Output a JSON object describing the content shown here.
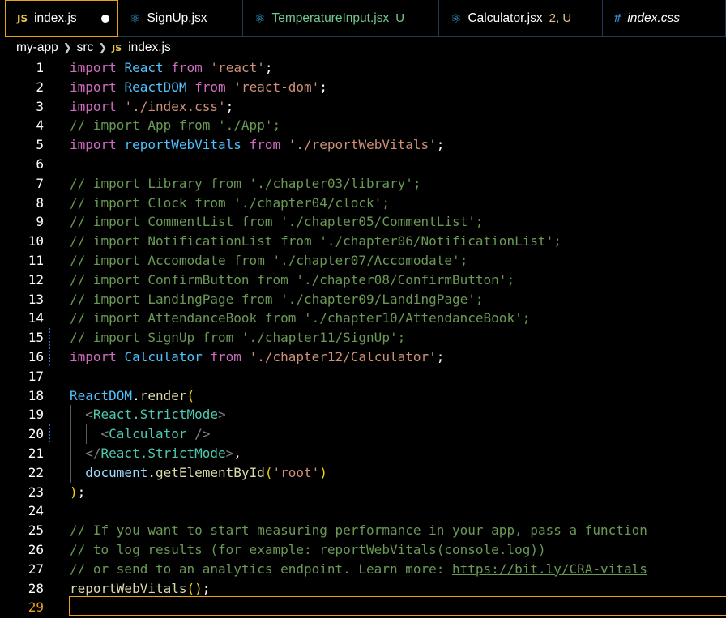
{
  "tabs": [
    {
      "label": "index.js",
      "icon": "js-icon",
      "icon_text": "JS",
      "status": "",
      "active": true,
      "dirty": true
    },
    {
      "label": "SignUp.jsx",
      "icon": "react-icon",
      "icon_text": "⚛",
      "status": "",
      "active": false
    },
    {
      "label": "TemperatureInput.jsx",
      "icon": "react-icon",
      "icon_text": "⚛",
      "status": "U",
      "active": false
    },
    {
      "label": "Calculator.jsx",
      "icon": "react-icon",
      "icon_text": "⚛",
      "status": "2, U",
      "active": false
    },
    {
      "label": "index.css",
      "icon": "css-icon",
      "icon_text": "#",
      "status": "",
      "active": false
    }
  ],
  "breadcrumb": {
    "root": "my-app",
    "folder": "src",
    "file": "index.js",
    "file_icon": "JS"
  },
  "lines": [
    [
      [
        "kw",
        "import"
      ],
      [
        "punc",
        " "
      ],
      [
        "id",
        "React"
      ],
      [
        "punc",
        " "
      ],
      [
        "kw",
        "from"
      ],
      [
        "punc",
        " "
      ],
      [
        "str",
        "'react'"
      ],
      [
        "punc",
        ";"
      ]
    ],
    [
      [
        "kw",
        "import"
      ],
      [
        "punc",
        " "
      ],
      [
        "id",
        "ReactDOM"
      ],
      [
        "punc",
        " "
      ],
      [
        "kw",
        "from"
      ],
      [
        "punc",
        " "
      ],
      [
        "str",
        "'react-dom'"
      ],
      [
        "punc",
        ";"
      ]
    ],
    [
      [
        "kw",
        "import"
      ],
      [
        "punc",
        " "
      ],
      [
        "str",
        "'./index.css'"
      ],
      [
        "punc",
        ";"
      ]
    ],
    [
      [
        "cmt",
        "// import App from './App';"
      ]
    ],
    [
      [
        "kw",
        "import"
      ],
      [
        "punc",
        " "
      ],
      [
        "id",
        "reportWebVitals"
      ],
      [
        "punc",
        " "
      ],
      [
        "kw",
        "from"
      ],
      [
        "punc",
        " "
      ],
      [
        "str",
        "'./reportWebVitals'"
      ],
      [
        "punc",
        ";"
      ]
    ],
    [],
    [
      [
        "cmt",
        "// import Library from './chapter03/library';"
      ]
    ],
    [
      [
        "cmt",
        "// import Clock from './chapter04/clock';"
      ]
    ],
    [
      [
        "cmt",
        "// import CommentList from './chapter05/CommentList';"
      ]
    ],
    [
      [
        "cmt",
        "// import NotificationList from './chapter06/NotificationList';"
      ]
    ],
    [
      [
        "cmt",
        "// import Accomodate from './chapter07/Accomodate';"
      ]
    ],
    [
      [
        "cmt",
        "// import ConfirmButton from './chapter08/ConfirmButton';"
      ]
    ],
    [
      [
        "cmt",
        "// import LandingPage from './chapter09/LandingPage';"
      ]
    ],
    [
      [
        "cmt",
        "// import AttendanceBook from './chapter10/AttendanceBook';"
      ]
    ],
    [
      [
        "cmt",
        "// import SignUp from './chapter11/SignUp';"
      ]
    ],
    [
      [
        "kw",
        "import"
      ],
      [
        "punc",
        " "
      ],
      [
        "id",
        "Calculator"
      ],
      [
        "punc",
        " "
      ],
      [
        "kw",
        "from"
      ],
      [
        "punc",
        " "
      ],
      [
        "str",
        "'./chapter12/Calculator'"
      ],
      [
        "punc",
        ";"
      ]
    ],
    [],
    [
      [
        "id",
        "ReactDOM"
      ],
      [
        "punc",
        "."
      ],
      [
        "fn",
        "render"
      ],
      [
        "paren",
        "("
      ]
    ],
    [
      [
        "punc",
        "  "
      ],
      [
        "lt",
        "<"
      ],
      [
        "tag",
        "React.StrictMode"
      ],
      [
        "lt",
        ">"
      ]
    ],
    [
      [
        "punc",
        "    "
      ],
      [
        "lt",
        "<"
      ],
      [
        "tag",
        "Calculator"
      ],
      [
        "punc",
        " "
      ],
      [
        "lt",
        "/>"
      ]
    ],
    [
      [
        "punc",
        "  "
      ],
      [
        "lt",
        "</"
      ],
      [
        "tag",
        "React.StrictMode"
      ],
      [
        "lt",
        ">"
      ],
      [
        "punc",
        ","
      ]
    ],
    [
      [
        "punc",
        "  "
      ],
      [
        "var",
        "document"
      ],
      [
        "punc",
        "."
      ],
      [
        "fn",
        "getElementById"
      ],
      [
        "paren",
        "("
      ],
      [
        "str",
        "'root'"
      ],
      [
        "paren",
        ")"
      ]
    ],
    [
      [
        "paren",
        ")"
      ],
      [
        "punc",
        ";"
      ]
    ],
    [],
    [
      [
        "cmt",
        "// If you want to start measuring performance in your app, pass a function"
      ]
    ],
    [
      [
        "cmt",
        "// to log results (for example: reportWebVitals(console.log))"
      ]
    ],
    [
      [
        "cmt",
        "// or send to an analytics endpoint. Learn more: "
      ],
      [
        "link",
        "https://bit.ly/CRA-vitals"
      ]
    ],
    [
      [
        "fn",
        "reportWebVitals"
      ],
      [
        "paren",
        "()"
      ],
      [
        "punc",
        ";"
      ]
    ],
    []
  ],
  "line_numbers": [
    "1",
    "2",
    "3",
    "4",
    "5",
    "6",
    "7",
    "8",
    "9",
    "10",
    "11",
    "12",
    "13",
    "14",
    "15",
    "16",
    "17",
    "18",
    "19",
    "20",
    "21",
    "22",
    "23",
    "24",
    "25",
    "26",
    "27",
    "28",
    "29"
  ],
  "current_line": 29,
  "modified_lines": [
    15,
    16,
    20
  ]
}
